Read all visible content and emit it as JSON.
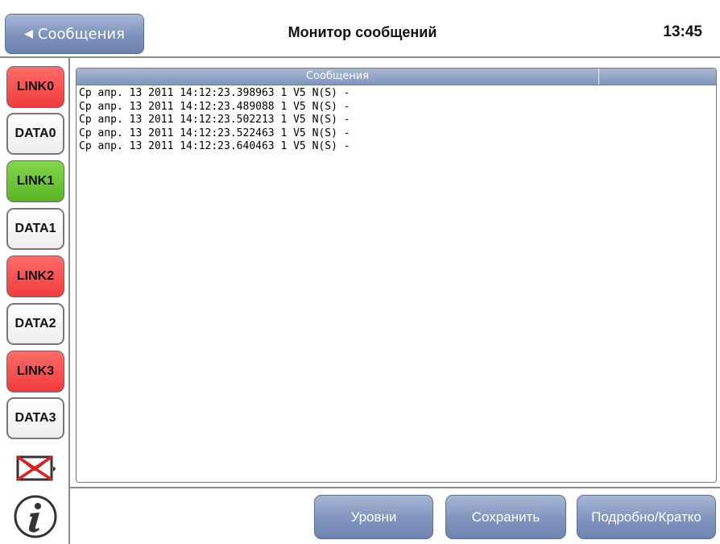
{
  "header": {
    "back_label": "Сообщения",
    "title": "Монитор сообщений",
    "time": "13:45"
  },
  "sidebar": {
    "items": [
      {
        "label": "LINK0",
        "color": "#f03c3c"
      },
      {
        "label": "DATA0",
        "color": "#ffffff"
      },
      {
        "label": "LINK1",
        "color": "#5ab526"
      },
      {
        "label": "DATA1",
        "color": "#ffffff"
      },
      {
        "label": "LINK2",
        "color": "#f03c3c"
      },
      {
        "label": "DATA2",
        "color": "#ffffff"
      },
      {
        "label": "LINK3",
        "color": "#f03c3c"
      },
      {
        "label": "DATA3",
        "color": "#ffffff"
      }
    ],
    "icons": [
      "envelope-error-icon",
      "info-icon"
    ]
  },
  "messages": {
    "column_header": "Сообщения",
    "rows": [
      "Ср апр. 13 2011 14:12:23.398963 1 V5 N(S) -",
      "Ср апр. 13 2011 14:12:23.489088 1 V5 N(S) -",
      "Ср апр. 13 2011 14:12:23.502213 1 V5 N(S) -",
      "Ср апр. 13 2011 14:12:23.522463 1 V5 N(S) -",
      "Ср апр. 13 2011 14:12:23.640463 1 V5 N(S) -"
    ]
  },
  "footer": {
    "levels_label": "Уровни",
    "save_label": "Сохранить",
    "detail_label": "Подробно/Кратко"
  }
}
